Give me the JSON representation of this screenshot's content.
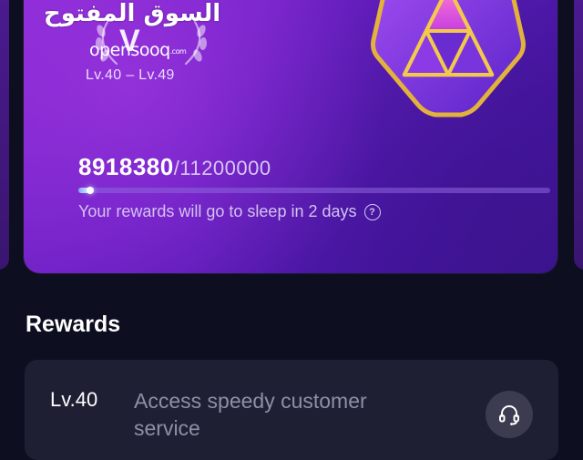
{
  "watermark": {
    "arabic": "السوق المفتوح",
    "latin": "opensooq",
    "domain": ".com"
  },
  "tier": {
    "letter": "V",
    "level_range": "Lv.40 – Lv.49",
    "badge_icon": "triangle-gem-badge-icon"
  },
  "points": {
    "current": "8918380",
    "separator": "/",
    "total": "11200000",
    "progress_fraction": 0.0096
  },
  "sleep_notice": {
    "text": "Your rewards will go to sleep in 2 days",
    "help_icon_glyph": "?"
  },
  "rewards": {
    "title": "Rewards",
    "items": [
      {
        "level": "Lv.40",
        "description": "Access speedy customer service",
        "icon": "headset-icon"
      }
    ]
  },
  "colors": {
    "background": "#0d0e1f",
    "card_gradient_start": "#8a2ad6",
    "card_gradient_end": "#3b1290",
    "badge_gold": "#e2b23a",
    "reward_card": "#1e1f33"
  }
}
